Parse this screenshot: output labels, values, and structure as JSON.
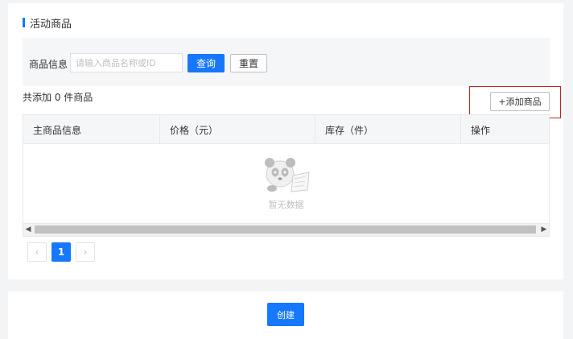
{
  "section": {
    "title": "活动商品"
  },
  "filter": {
    "label": "商品信息",
    "search_placeholder": "请输入商品名称或ID",
    "search_value": "",
    "query_label": "查询",
    "reset_label": "重置"
  },
  "summary": {
    "count_text": "共添加 0 件商品",
    "add_label": "+添加商品"
  },
  "table": {
    "columns": [
      "主商品信息",
      "价格（元）",
      "库存（件）",
      "操作"
    ],
    "empty_text": "暂无数据"
  },
  "pagination": {
    "prev": "‹",
    "current": "1",
    "next": "›"
  },
  "footer": {
    "create_label": "创建"
  },
  "colors": {
    "primary": "#1677ff",
    "highlight_border": "#c82020"
  }
}
